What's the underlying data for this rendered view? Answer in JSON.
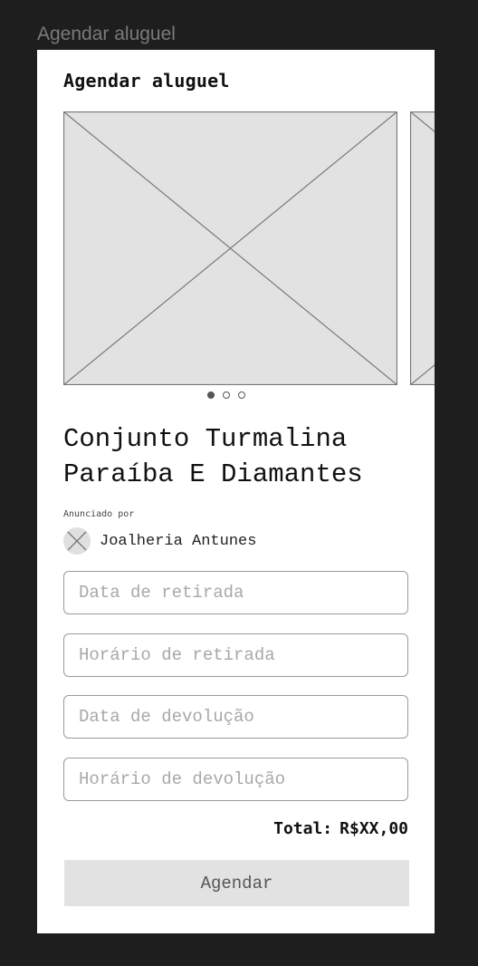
{
  "frame": {
    "label": "Agendar aluguel"
  },
  "screen": {
    "title": "Agendar aluguel"
  },
  "carousel": {
    "image_count": 3,
    "active_index": 0
  },
  "product": {
    "title": "Conjunto Turmalina Paraíba E Diamantes",
    "announced_by_label": "Anunciado por",
    "seller_name": "Joalheria Antunes"
  },
  "form": {
    "pickup_date_placeholder": "Data de retirada",
    "pickup_time_placeholder": "Horário de retirada",
    "return_date_placeholder": "Data de devolução",
    "return_time_placeholder": "Horário de devolução"
  },
  "summary": {
    "total_label": "Total:",
    "total_value": "R$XX,00"
  },
  "actions": {
    "submit_label": "Agendar"
  },
  "colors": {
    "canvas_background": "#1e1e1e",
    "screen_background": "#ffffff",
    "placeholder_fill": "#e2e2e2",
    "button_fill": "#e2e2e2"
  }
}
